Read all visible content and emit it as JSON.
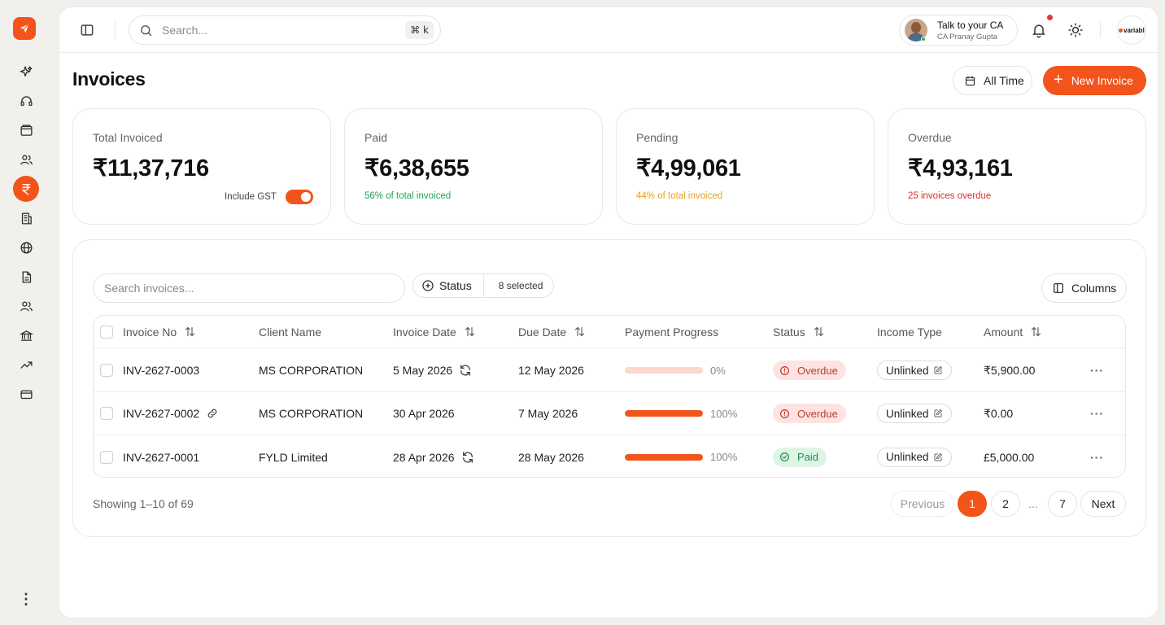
{
  "rail": {
    "items": [
      "sparkle-icon",
      "headset-icon",
      "wallet-icon",
      "users-icon",
      "rupee-icon",
      "building-icon",
      "globe-icon",
      "document-icon",
      "team-icon",
      "bank-icon",
      "trending-up-icon",
      "card-icon"
    ],
    "active": "rupee-icon",
    "more": "⋮"
  },
  "topbar": {
    "search_placeholder": "Search...",
    "shortcut": "⌘ k",
    "ca_title": "Talk to your CA",
    "ca_name": "CA Pranay Gupta",
    "brand": "variabl"
  },
  "page": {
    "title": "Invoices",
    "all_time": "All Time",
    "new_invoice": "New Invoice"
  },
  "stats": {
    "total": {
      "label": "Total Invoiced",
      "value": "₹11,37,716",
      "gst_label": "Include GST",
      "gst_on": true
    },
    "paid": {
      "label": "Paid",
      "value": "₹6,38,655",
      "note": "56% of total invoiced",
      "note_color": "#27a35a"
    },
    "pending": {
      "label": "Pending",
      "value": "₹4,99,061",
      "note": "44% of total invoiced",
      "note_color": "#e8a317"
    },
    "overdue": {
      "label": "Overdue",
      "value": "₹4,93,161",
      "note": "25 invoices overdue",
      "note_color": "#d93025"
    }
  },
  "filters": {
    "search_placeholder": "Search invoices...",
    "status_label": "Status",
    "status_selected": "8 selected",
    "columns_label": "Columns"
  },
  "table": {
    "headers": {
      "invoice_no": "Invoice No",
      "client": "Client Name",
      "invoice_date": "Invoice Date",
      "due_date": "Due Date",
      "progress": "Payment Progress",
      "status": "Status",
      "income_type": "Income Type",
      "amount": "Amount"
    },
    "rows": [
      {
        "invoice_no": "INV-2627-0003",
        "inv_icon": "",
        "client": "MS CORPORATION",
        "invoice_date": "5 May 2026",
        "date_icon": "refresh-icon",
        "due_date": "12 May 2026",
        "progress": 0,
        "progress_label": "0%",
        "status": "Overdue",
        "status_kind": "overdue",
        "income_type": "Unlinked",
        "amount": "₹5,900.00"
      },
      {
        "invoice_no": "INV-2627-0002",
        "inv_icon": "link-icon",
        "client": "MS CORPORATION",
        "invoice_date": "30 Apr 2026",
        "date_icon": "",
        "due_date": "7 May 2026",
        "progress": 100,
        "progress_label": "100%",
        "status": "Overdue",
        "status_kind": "overdue",
        "income_type": "Unlinked",
        "amount": "₹0.00"
      },
      {
        "invoice_no": "INV-2627-0001",
        "inv_icon": "",
        "client": "FYLD Limited",
        "invoice_date": "28 Apr 2026",
        "date_icon": "refresh-icon",
        "due_date": "28 May 2026",
        "progress": 100,
        "progress_label": "100%",
        "status": "Paid",
        "status_kind": "paid",
        "income_type": "Unlinked",
        "amount": "£5,000.00"
      }
    ],
    "row_menu": "···"
  },
  "pagination": {
    "showing": "Showing 1–10 of 69",
    "previous": "Previous",
    "pages": [
      "1",
      "2",
      "...",
      "7"
    ],
    "current": "1",
    "next": "Next"
  },
  "colors": {
    "accent": "#f2541b"
  }
}
